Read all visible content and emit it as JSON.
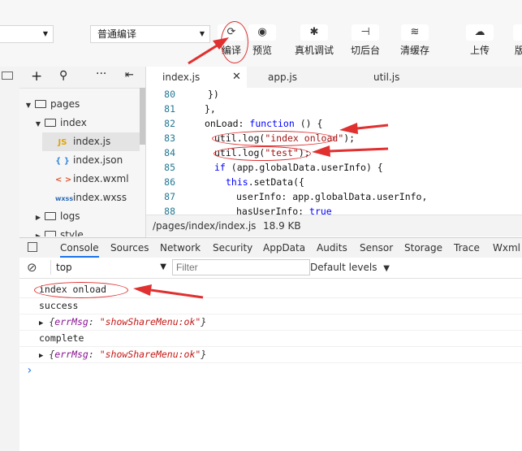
{
  "toolbar": {
    "mode_select": "普通编译",
    "buttons": [
      {
        "label": "编译",
        "icon": "refresh-icon"
      },
      {
        "label": "预览",
        "icon": "eye-icon"
      },
      {
        "label": "真机调试",
        "icon": "bug-icon"
      },
      {
        "label": "切后台",
        "icon": "switch-icon"
      },
      {
        "label": "清缓存",
        "icon": "layers-icon"
      },
      {
        "label": "上传",
        "icon": "cloud-upload-icon"
      },
      {
        "label": "版",
        "icon": "version-icon"
      }
    ]
  },
  "tree": {
    "items": [
      {
        "label": "pages",
        "type": "folder",
        "expanded": true
      },
      {
        "label": "index",
        "type": "folder",
        "expanded": true
      },
      {
        "label": "index.js",
        "type": "js",
        "icon_text": "JS",
        "selected": true
      },
      {
        "label": "index.json",
        "type": "json",
        "icon_text": "{ }"
      },
      {
        "label": "index.wxml",
        "type": "wxml",
        "icon_text": "< >"
      },
      {
        "label": "index.wxss",
        "type": "wxss",
        "icon_text": "wxss"
      },
      {
        "label": "logs",
        "type": "folder",
        "expanded": false
      },
      {
        "label": "style",
        "type": "folder",
        "expanded": false
      }
    ]
  },
  "editor": {
    "tabs": [
      {
        "label": "index.js",
        "active": true
      },
      {
        "label": "app.js",
        "active": false
      },
      {
        "label": "util.js",
        "active": false
      }
    ],
    "lines": [
      {
        "n": "80",
        "text": "  })"
      },
      {
        "n": "81",
        "text": "},"
      },
      {
        "n": "82",
        "text": "onLoad: function () {"
      },
      {
        "n": "83",
        "text": "  util.log(\"index onload\");"
      },
      {
        "n": "84",
        "text": "  util.log(\"test\");"
      },
      {
        "n": "85",
        "text": "  if (app.globalData.userInfo) {"
      },
      {
        "n": "86",
        "text": "    this.setData({"
      },
      {
        "n": "87",
        "text": "      userInfo: app.globalData.userInfo,"
      },
      {
        "n": "88",
        "text": "      hasUserInfo: true"
      }
    ],
    "status_path": "/pages/index/index.js",
    "status_size": "18.9 KB"
  },
  "devtools": {
    "tabs": [
      "Console",
      "Sources",
      "Network",
      "Security",
      "AppData",
      "Audits",
      "Sensor",
      "Storage",
      "Trace",
      "Wxml"
    ],
    "context": "top",
    "filter_placeholder": "Filter",
    "levels": "Default levels"
  },
  "console": {
    "lines": [
      {
        "type": "text",
        "text": "index onload"
      },
      {
        "type": "text",
        "text": "success"
      },
      {
        "type": "object",
        "key": "errMsg",
        "value": "\"showShareMenu:ok\""
      },
      {
        "type": "text",
        "text": "complete"
      },
      {
        "type": "object",
        "key": "errMsg",
        "value": "\"showShareMenu:ok\""
      }
    ],
    "prompt": "›"
  },
  "colors": {
    "annotation": "#e03030",
    "accent": "#1a73e8"
  }
}
